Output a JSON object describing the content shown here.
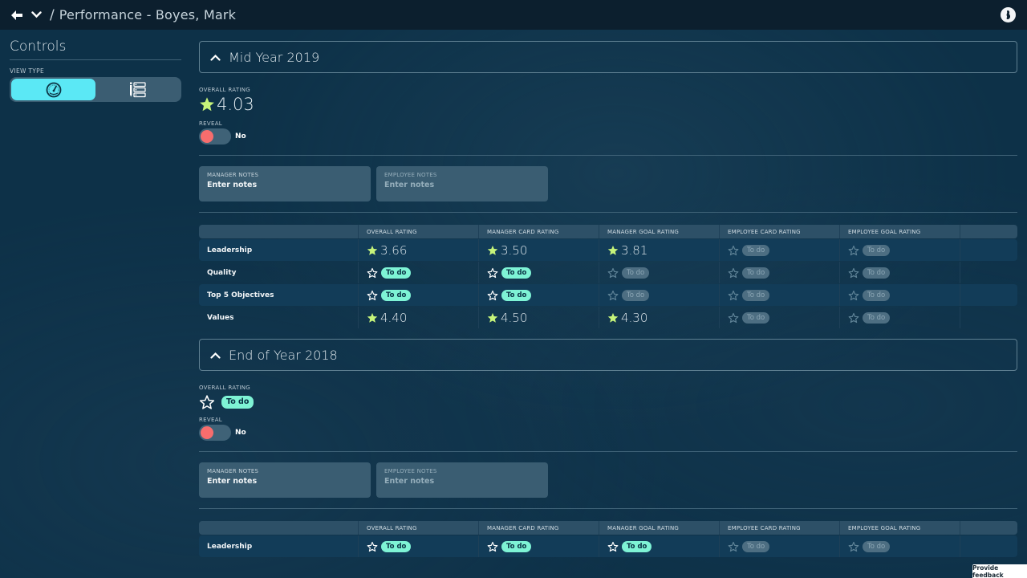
{
  "topbar": {
    "back_icon": "arrow-left-icon",
    "menu_icon": "chevron-down-icon",
    "separator": "/",
    "title": "Performance - Boyes, Mark",
    "user_icon": "user-avatar-icon"
  },
  "sidebar": {
    "heading": "Controls",
    "view_type_label": "VIEW TYPE",
    "view_options": [
      {
        "icon": "speedometer-icon",
        "active": true
      },
      {
        "icon": "list-icon",
        "active": false
      }
    ]
  },
  "colors": {
    "accent": "#5be8f5",
    "star_filled": "#c6f47a",
    "todo_badge": "#7ef3d5",
    "toggle_off": "#f76d6d",
    "background": "#0d3148",
    "topbar": "#0c1f2e"
  },
  "sections": [
    {
      "title": "Mid Year 2019",
      "expanded": true,
      "overall_label": "OVERALL RATING",
      "overall_value": "4.03",
      "reveal_label": "REVEAL",
      "reveal_value": "No",
      "manager_notes": {
        "label": "MANAGER NOTES",
        "placeholder": "Enter notes"
      },
      "employee_notes": {
        "label": "EMPLOYEE NOTES",
        "placeholder": "Enter notes"
      },
      "columns": [
        "",
        "OVERALL RATING",
        "MANAGER CARD RATING",
        "MANAGER GOAL RATING",
        "EMPLOYEE CARD RATING",
        "EMPLOYEE GOAL RATING",
        ""
      ],
      "rows": [
        {
          "name": "Leadership",
          "cells": [
            {
              "value": "3.66",
              "state": "rated"
            },
            {
              "value": "3.50",
              "state": "rated"
            },
            {
              "value": "3.81",
              "state": "rated"
            },
            {
              "value": "To do",
              "state": "muted"
            },
            {
              "value": "To do",
              "state": "muted"
            }
          ]
        },
        {
          "name": "Quality",
          "cells": [
            {
              "value": "To do",
              "state": "todo"
            },
            {
              "value": "To do",
              "state": "todo"
            },
            {
              "value": "To do",
              "state": "muted"
            },
            {
              "value": "To do",
              "state": "muted"
            },
            {
              "value": "To do",
              "state": "muted"
            }
          ]
        },
        {
          "name": "Top 5 Objectives",
          "cells": [
            {
              "value": "To do",
              "state": "todo"
            },
            {
              "value": "To do",
              "state": "todo"
            },
            {
              "value": "To do",
              "state": "muted"
            },
            {
              "value": "To do",
              "state": "muted"
            },
            {
              "value": "To do",
              "state": "muted"
            }
          ]
        },
        {
          "name": "Values",
          "cells": [
            {
              "value": "4.40",
              "state": "rated"
            },
            {
              "value": "4.50",
              "state": "rated"
            },
            {
              "value": "4.30",
              "state": "rated"
            },
            {
              "value": "To do",
              "state": "muted"
            },
            {
              "value": "To do",
              "state": "muted"
            }
          ]
        }
      ]
    },
    {
      "title": "End of Year 2018",
      "expanded": true,
      "overall_label": "OVERALL RATING",
      "overall_value": "To do",
      "reveal_label": "REVEAL",
      "reveal_value": "No",
      "manager_notes": {
        "label": "MANAGER NOTES",
        "placeholder": "Enter notes"
      },
      "employee_notes": {
        "label": "EMPLOYEE NOTES",
        "placeholder": "Enter notes"
      },
      "columns": [
        "",
        "OVERALL RATING",
        "MANAGER CARD RATING",
        "MANAGER GOAL RATING",
        "EMPLOYEE CARD RATING",
        "EMPLOYEE GOAL RATING",
        ""
      ],
      "rows": [
        {
          "name": "Leadership",
          "cells": [
            {
              "value": "To do",
              "state": "todo"
            },
            {
              "value": "To do",
              "state": "todo"
            },
            {
              "value": "To do",
              "state": "todo"
            },
            {
              "value": "To do",
              "state": "muted"
            },
            {
              "value": "To do",
              "state": "muted"
            }
          ]
        }
      ]
    }
  ],
  "feedback": {
    "label": "Provide feedback"
  }
}
